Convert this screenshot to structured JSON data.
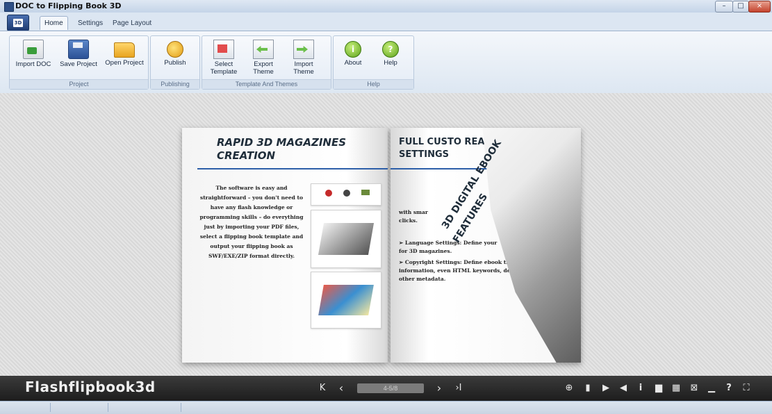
{
  "window": {
    "title": "DOC to Flipping Book 3D",
    "controls": {
      "minimize": "–",
      "maximize": "□",
      "close": "×"
    }
  },
  "ribbon": {
    "app_button": "3D",
    "tabs": [
      {
        "label": "Home",
        "active": true
      },
      {
        "label": "Settings",
        "active": false
      },
      {
        "label": "Page Layout",
        "active": false
      }
    ],
    "groups": {
      "project": {
        "label": "Project",
        "buttons": [
          {
            "label": "Import DOC",
            "icon": "import-doc-icon"
          },
          {
            "label": "Save Project",
            "icon": "save-icon"
          },
          {
            "label": "Open Project",
            "icon": "folder-icon"
          }
        ]
      },
      "publishing": {
        "label": "Publishing",
        "buttons": [
          {
            "label": "Publish",
            "icon": "publish-icon"
          }
        ]
      },
      "templates": {
        "label": "Template  And Themes",
        "buttons": [
          {
            "label": "Select\nTemplate",
            "icon": "template-icon"
          },
          {
            "label": "Export\nTheme",
            "icon": "export-theme-icon"
          },
          {
            "label": "Import\nTheme",
            "icon": "import-theme-icon"
          }
        ]
      },
      "help": {
        "label": "Help",
        "buttons": [
          {
            "label": "About",
            "icon": "info-icon",
            "glyph": "i"
          },
          {
            "label": "Help",
            "icon": "help-icon",
            "glyph": "?"
          }
        ]
      }
    }
  },
  "book": {
    "left_page": {
      "heading_line1": "RAPID 3D MAGAZINES",
      "heading_line2": "CREATION",
      "body": "The software is easy and straightforward – you don't need to have any flash knowledge or programming skills – do everything just by importing your PDF files, select a flipping book template and output your flipping book as SWF/EXE/ZIP format directly."
    },
    "right_page": {
      "heading_line1": "FULL CUSTO    REATE",
      "heading_line2": "SETTINGS",
      "lines": [
        "with smar",
        "clicks.",
        "➢  Language Settings: Define your",
        "for 3D magazines.",
        "➢  Copyright Settings: Define ebook title, logo,",
        "information, even HTML keywords, description and",
        "other metadata."
      ]
    },
    "curl": {
      "title_line1": "3D DIGITAL EBOOK",
      "title_line2": "FEATURES"
    }
  },
  "toolbar": {
    "brand": "Flashflipbook3d",
    "page_indicator": "4-5/8",
    "nav": {
      "first": "K",
      "prev": "‹",
      "next": "›",
      "last": "›I"
    },
    "tools": [
      "zoom-in-icon",
      "thumbnails-icon",
      "play-icon",
      "sound-icon",
      "info-icon",
      "bookmark-icon",
      "grid-icon",
      "share-icon",
      "print-icon",
      "help-icon",
      "fullscreen-icon"
    ],
    "tool_glyphs": [
      "⊕",
      "▮",
      "▶",
      "◀",
      "i",
      "▆",
      "▦",
      "⊠",
      "▁",
      "?",
      "⛶"
    ]
  },
  "colors": {
    "accent_blue": "#2c5ea8",
    "toolbar_dark": "#2a2a2a",
    "ribbon_bg": "#e4ecf6"
  }
}
